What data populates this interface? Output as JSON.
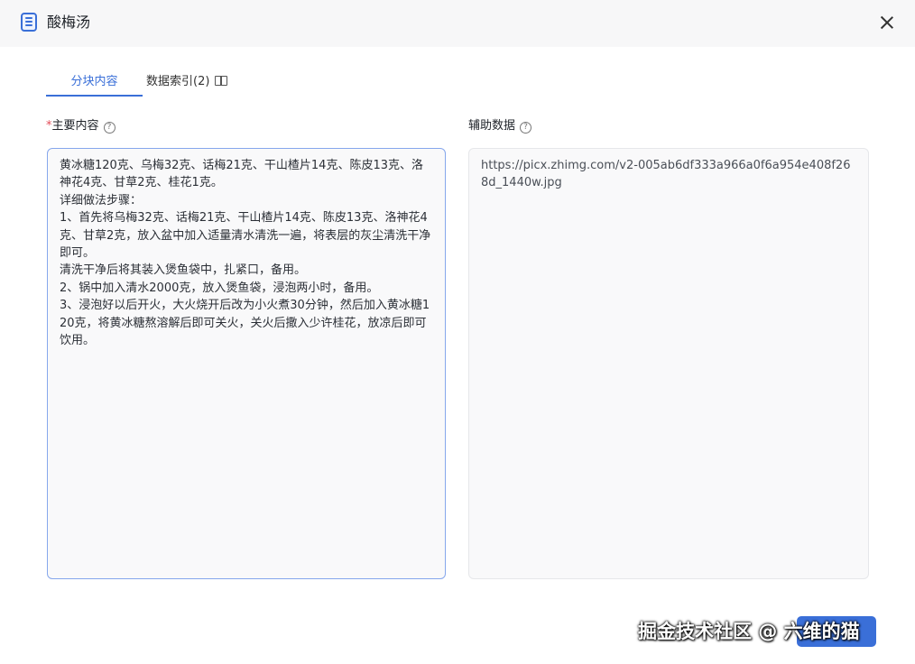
{
  "dialog": {
    "title": "酸梅汤",
    "icon": "document-list-icon",
    "close_icon": "close-icon"
  },
  "tabs": [
    {
      "label": "分块内容",
      "active": true
    },
    {
      "label": "数据索引(2)",
      "active": false,
      "icon": "book-icon"
    }
  ],
  "main_content": {
    "required_mark": "*",
    "label": "主要内容",
    "help_icon": "question-circle-icon",
    "value": "黄冰糖120克、乌梅32克、话梅21克、干山楂片14克、陈皮13克、洛神花4克、甘草2克、桂花1克。\n详细做法步骤：\n1、首先将乌梅32克、话梅21克、干山楂片14克、陈皮13克、洛神花4克、甘草2克，放入盆中加入适量清水清洗一遍，将表层的灰尘清洗干净即可。\n清洗干净后将其装入煲鱼袋中，扎紧口，备用。\n2、锅中加入清水2000克，放入煲鱼袋，浸泡两小时，备用。\n3、浸泡好以后开火，大火烧开后改为小火煮30分钟，然后加入黄冰糖120克，将黄冰糖熬溶解后即可关火，关火后撒入少许桂花，放凉后即可饮用。"
  },
  "aux_data": {
    "label": "辅助数据",
    "help_icon": "question-circle-icon",
    "value": "https://picx.zhimg.com/v2-005ab6df333a966a0f6a954e408f268d_1440w.jpg"
  },
  "footer": {
    "watermark": "掘金技术社区 @ 六维的猫"
  },
  "colors": {
    "accent": "#3a6fd8",
    "required": "#e34d59"
  }
}
